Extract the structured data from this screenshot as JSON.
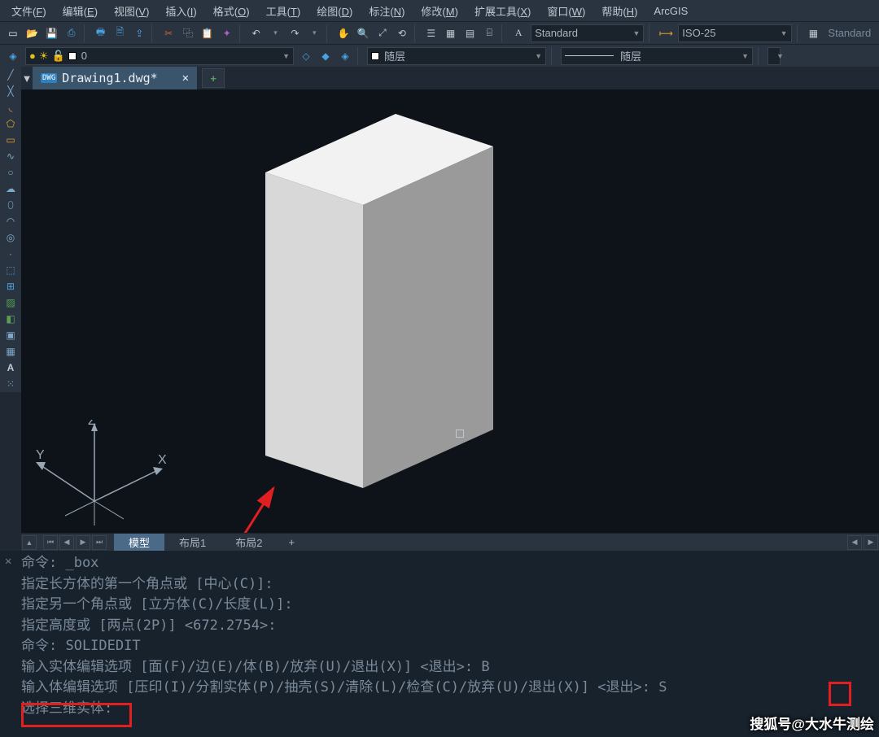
{
  "menu": {
    "items": [
      {
        "l": "文件",
        "k": "F"
      },
      {
        "l": "编辑",
        "k": "E"
      },
      {
        "l": "视图",
        "k": "V"
      },
      {
        "l": "插入",
        "k": "I"
      },
      {
        "l": "格式",
        "k": "O"
      },
      {
        "l": "工具",
        "k": "T"
      },
      {
        "l": "绘图",
        "k": "D"
      },
      {
        "l": "标注",
        "k": "N"
      },
      {
        "l": "修改",
        "k": "M"
      },
      {
        "l": "扩展工具",
        "k": "X"
      },
      {
        "l": "窗口",
        "k": "W"
      },
      {
        "l": "帮助",
        "k": "H"
      }
    ],
    "arcgis": "ArcGIS"
  },
  "styles": {
    "textstyle": "Standard",
    "dimstyle": "ISO-25",
    "tablestyle": "Standard"
  },
  "layer": {
    "name": "0",
    "bylayer1": "随层",
    "bylayer2": "随层"
  },
  "file": {
    "title": "Drawing1.dwg*"
  },
  "viewtabs": {
    "model": "模型",
    "layout1": "布局1",
    "layout2": "布局2"
  },
  "ucs": {
    "x": "X",
    "y": "Y",
    "z": "Z"
  },
  "cmd": {
    "l1": "命令: _box",
    "l2": "指定长方体的第一个角点或 [中心(C)]:",
    "l3": "指定另一个角点或 [立方体(C)/长度(L)]:",
    "l4": "指定高度或 [两点(2P)] <672.2754>:",
    "l5": "命令: SOLIDEDIT",
    "l6": "输入实体编辑选项 [面(F)/边(E)/体(B)/放弃(U)/退出(X)] <退出>: B",
    "l7a": "输入体编辑选项 [压印(I)/分割实体(P)/抽壳(S)/清除(L)/检查(C)/放弃(U)/退出(X)] <退出>: ",
    "l7b": "S",
    "l8": "选择三维实体:"
  },
  "watermark": "搜狐号@大水牛测绘"
}
